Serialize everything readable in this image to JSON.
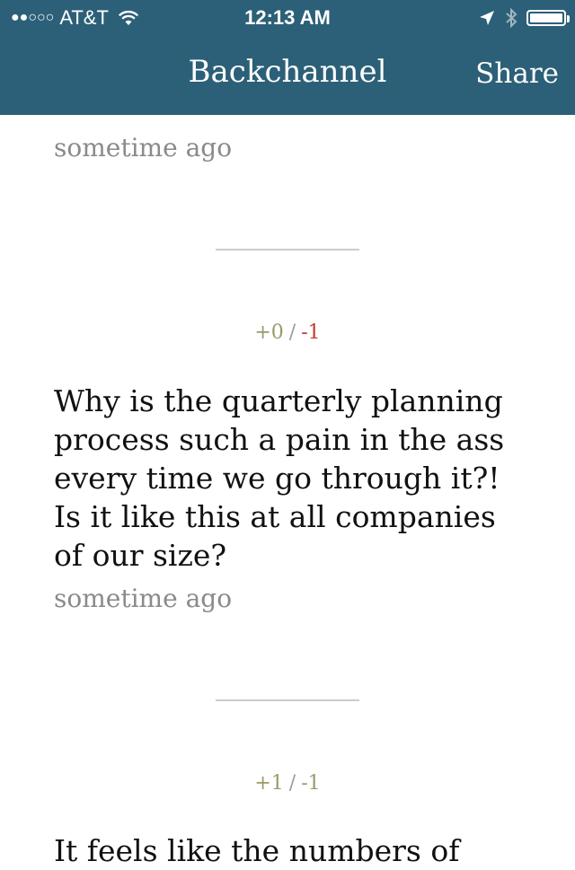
{
  "status": {
    "carrier": "AT&T",
    "time": "12:13 AM"
  },
  "nav": {
    "title": "Backchannel",
    "share": "Share"
  },
  "posts": [
    {
      "timestamp": "sometime ago"
    },
    {
      "up": "+0",
      "down": "-1",
      "body": "Why is the quarterly planning process such a pain in the ass every time we go through it?! Is it like this at all companies of our size?",
      "timestamp": "sometime ago"
    },
    {
      "up": "+1",
      "down": "-1",
      "body": "It feels like the numbers of"
    }
  ],
  "colors": {
    "bar": "#2c6078",
    "downvote_active": "#c0392b",
    "upvote": "#9a9a6a",
    "meta": "#8a8a8a"
  }
}
